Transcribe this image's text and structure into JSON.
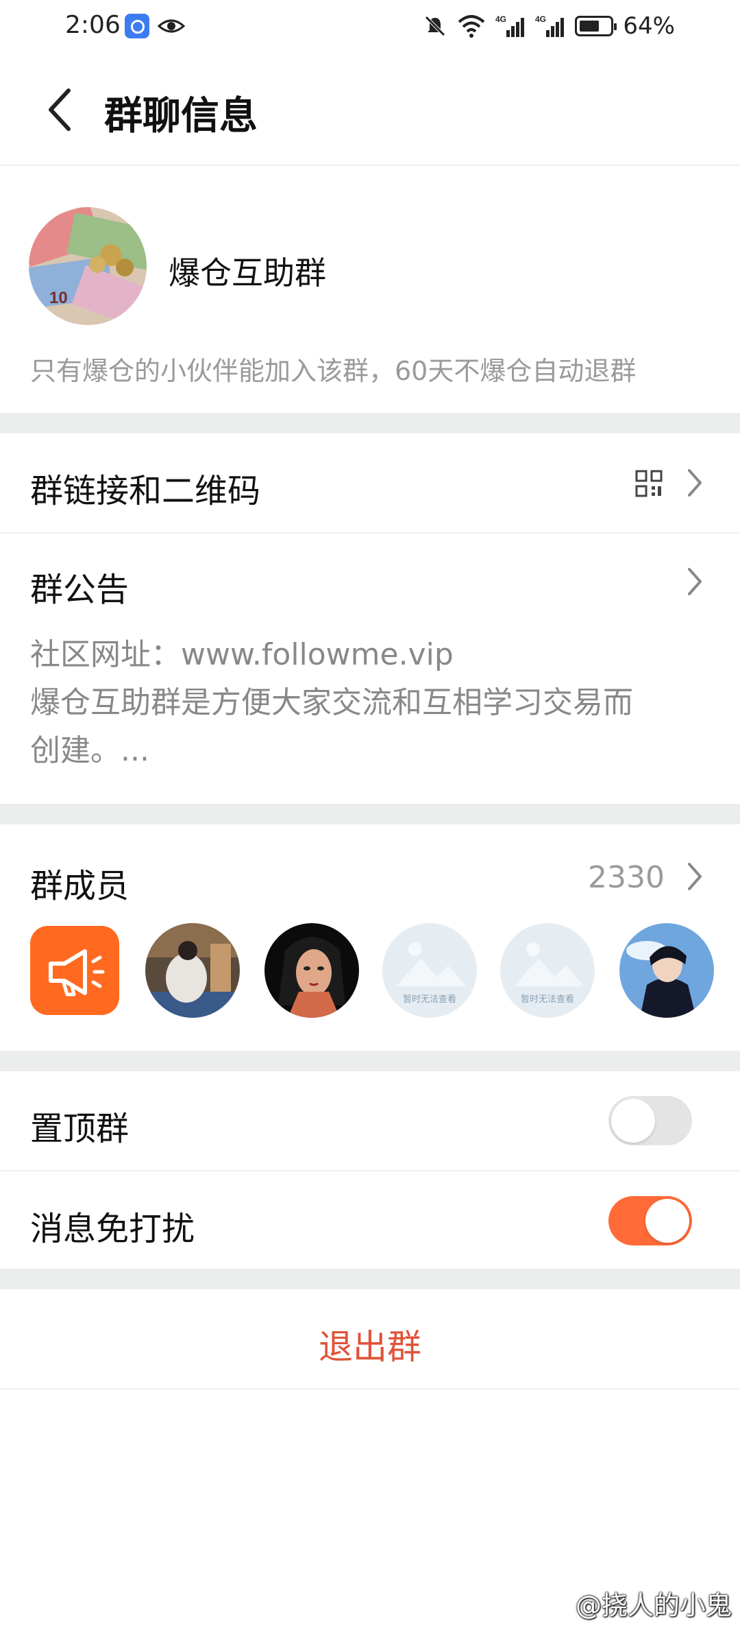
{
  "status_bar": {
    "time": "2:06",
    "battery_percent": "64%",
    "icons": [
      "app-notification-icon",
      "eye-icon",
      "mute-icon",
      "wifi-icon",
      "signal-4g-icon",
      "signal-4g-icon",
      "battery-icon"
    ]
  },
  "header": {
    "title": "群聊信息",
    "back_icon": "chevron-left-icon"
  },
  "group": {
    "name": "爆仓互助群",
    "description": "只有爆仓的小伙伴能加入该群，60天不爆仓自动退群"
  },
  "link_row": {
    "label": "群链接和二维码",
    "icon": "qr-code-icon"
  },
  "notice": {
    "label": "群公告",
    "lines": [
      "社区网址：www.followme.vip",
      "爆仓互助群是方便大家交流和互相学习交易而",
      "创建。..."
    ]
  },
  "members": {
    "label": "群成员",
    "count": "2330",
    "placeholder_text": "暂时无法查看",
    "avatars": [
      "announcement-icon",
      "photo",
      "photo",
      "placeholder",
      "placeholder",
      "photo"
    ]
  },
  "settings": {
    "pin_label": "置顶群",
    "pin_on": false,
    "mute_label": "消息免打扰",
    "mute_on": true
  },
  "exit": {
    "label": "退出群"
  },
  "watermark": "@挠人的小鬼",
  "colors": {
    "accent": "#ff6a37",
    "exit_red": "#e0533a",
    "divider": "#eceded",
    "secondary_text": "#9a9a9a"
  }
}
